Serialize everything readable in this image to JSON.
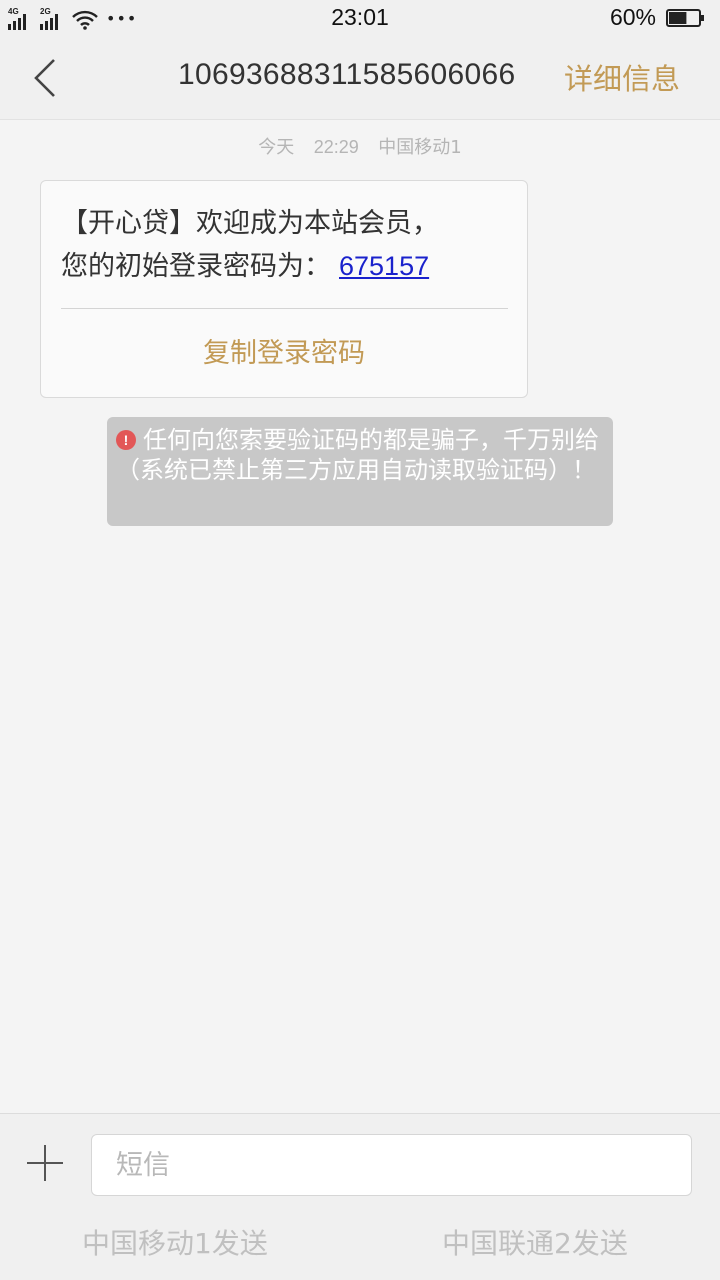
{
  "status_bar": {
    "signal1_label": "4G",
    "signal2_label": "2G",
    "more": "•••",
    "time": "23:01",
    "battery_text": "60%",
    "battery_level": 0.6
  },
  "header": {
    "title": "1069368831158560​6066",
    "details_label": "详细信息"
  },
  "conversation": {
    "timestamp_day": "今天",
    "timestamp_time": "22:29",
    "timestamp_sim": "中国移动1",
    "message": {
      "line1": "【开心贷】欢迎成为本站会员，",
      "line2_prefix": "您的初始登录密码为：",
      "code": "675157",
      "copy_label": "复制登录密码"
    },
    "warning": {
      "icon": "!",
      "text": "任何向您索要验证码的都是骗子，千万别给（系统已禁止第三方应用自动读取验证码）！"
    }
  },
  "composer": {
    "placeholder": "短信",
    "value": "",
    "send_sim1": "中国移动1发送",
    "send_sim2": "中国联通2发送"
  },
  "colors": {
    "accent": "#c29a55",
    "link": "#1a22cc",
    "warning_icon": "#e25757"
  }
}
